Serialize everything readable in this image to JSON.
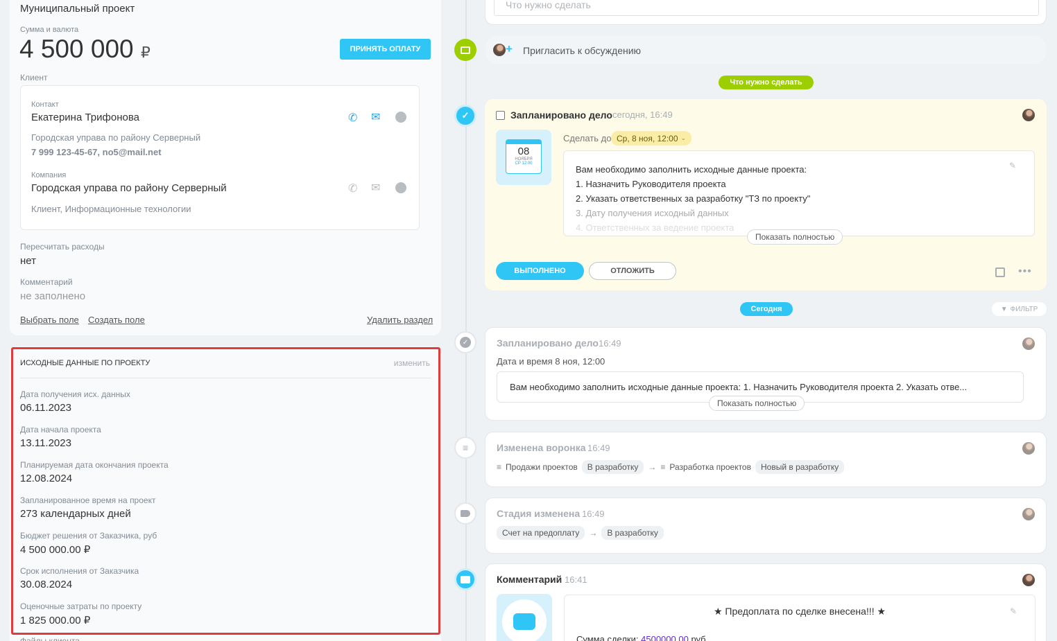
{
  "left": {
    "top_value": "Муниципальный проект",
    "amount_label": "Сумма и валюта",
    "amount": "4 500 000",
    "currency_symbol": "₽",
    "accept_payment": "ПРИНЯТЬ ОПЛАТУ",
    "client_label": "Клиент",
    "contact": {
      "label": "Контакт",
      "name": "Екатерина Трифонова",
      "org": "Городская управа по району Серверный",
      "details": "7 999 123-45-67, no5@mail.net"
    },
    "company": {
      "label": "Компания",
      "name": "Городская управа по району Серверный",
      "tags": "Клиент, Информационные технологии"
    },
    "recalc_label": "Пересчитать расходы",
    "recalc_value": "нет",
    "comment_label": "Комментарий",
    "comment_value": "не заполнено",
    "links": {
      "select": "Выбрать поле",
      "create": "Создать поле",
      "delete": "Удалить раздел"
    },
    "section": {
      "title": "ИСХОДНЫЕ ДАННЫЕ ПО ПРОЕКТУ",
      "edit": "изменить",
      "fields": [
        {
          "label": "Дата получения исх. данных",
          "value": "06.11.2023"
        },
        {
          "label": "Дата начала проекта",
          "value": "13.11.2023"
        },
        {
          "label": "Планируемая дата окончания проекта",
          "value": "12.08.2024"
        },
        {
          "label": "Запланированное время на проект",
          "value": "273 календарных дней"
        },
        {
          "label": "Бюджет решения от Заказчика, руб",
          "value": "4 500 000.00 ₽"
        },
        {
          "label": "Срок исполнения от Заказчика",
          "value": "30.08.2024"
        },
        {
          "label": "Оценочные затраты по проекту",
          "value": "1 825 000.00 ₽"
        }
      ],
      "next_label": "Файлы клиента"
    }
  },
  "timeline": {
    "todo_placeholder": "Что нужно сделать",
    "invite": "Пригласить к обсуждению",
    "todo_pill": "Что нужно сделать",
    "planned": {
      "title": "Запланировано дело",
      "time": "сегодня, 16:49",
      "deadline_label": "Сделать до",
      "deadline": "Ср, 8 ноя, 12:00",
      "cal_day": "08",
      "cal_month": "НОЯБРЯ",
      "cal_time": "СР 12:00",
      "lines": [
        "Вам необходимо заполнить исходные данные проекта:",
        "1. Назначить Руководителя проекта",
        "2. Указать ответственных за разработку \"ТЗ по проекту\"",
        "3. Дату получения исходный данных",
        "4. Ответственных за ведение проекта"
      ],
      "show_full": "Показать полностью",
      "done": "ВЫПОЛНЕНО",
      "postpone": "ОТЛОЖИТЬ"
    },
    "today_pill": "Сегодня",
    "filter": "ФИЛЬТР",
    "history1": {
      "title": "Запланировано дело",
      "time": "16:49",
      "datetime": "Дата и время 8 ноя, 12:00",
      "text": "Вам необходимо заполнить исходные данные проекта: 1. Назначить Руководителя проекта 2. Указать отве...",
      "show_full": "Показать полностью"
    },
    "history2": {
      "title": "Изменена воронка",
      "time": "16:49",
      "from_funnel": "Продажи проектов",
      "from_stage": "В разработку",
      "to_funnel": "Разработка проектов",
      "to_stage": "Новый в разработку"
    },
    "history3": {
      "title": "Стадия изменена",
      "time": "16:49",
      "from": "Счет на предоплату",
      "to": "В разработку"
    },
    "comment": {
      "title": "Комментарий",
      "time": "16:41",
      "headline": "★ Предоплата по сделке внесена!!! ★",
      "sum_label": "Сумма сделки:",
      "sum_value": "4500000.00",
      "sum_unit": "руб"
    }
  },
  "colors": {
    "accent": "#2fc6f6",
    "green": "#9dcf00",
    "danger": "#e03c3c"
  }
}
